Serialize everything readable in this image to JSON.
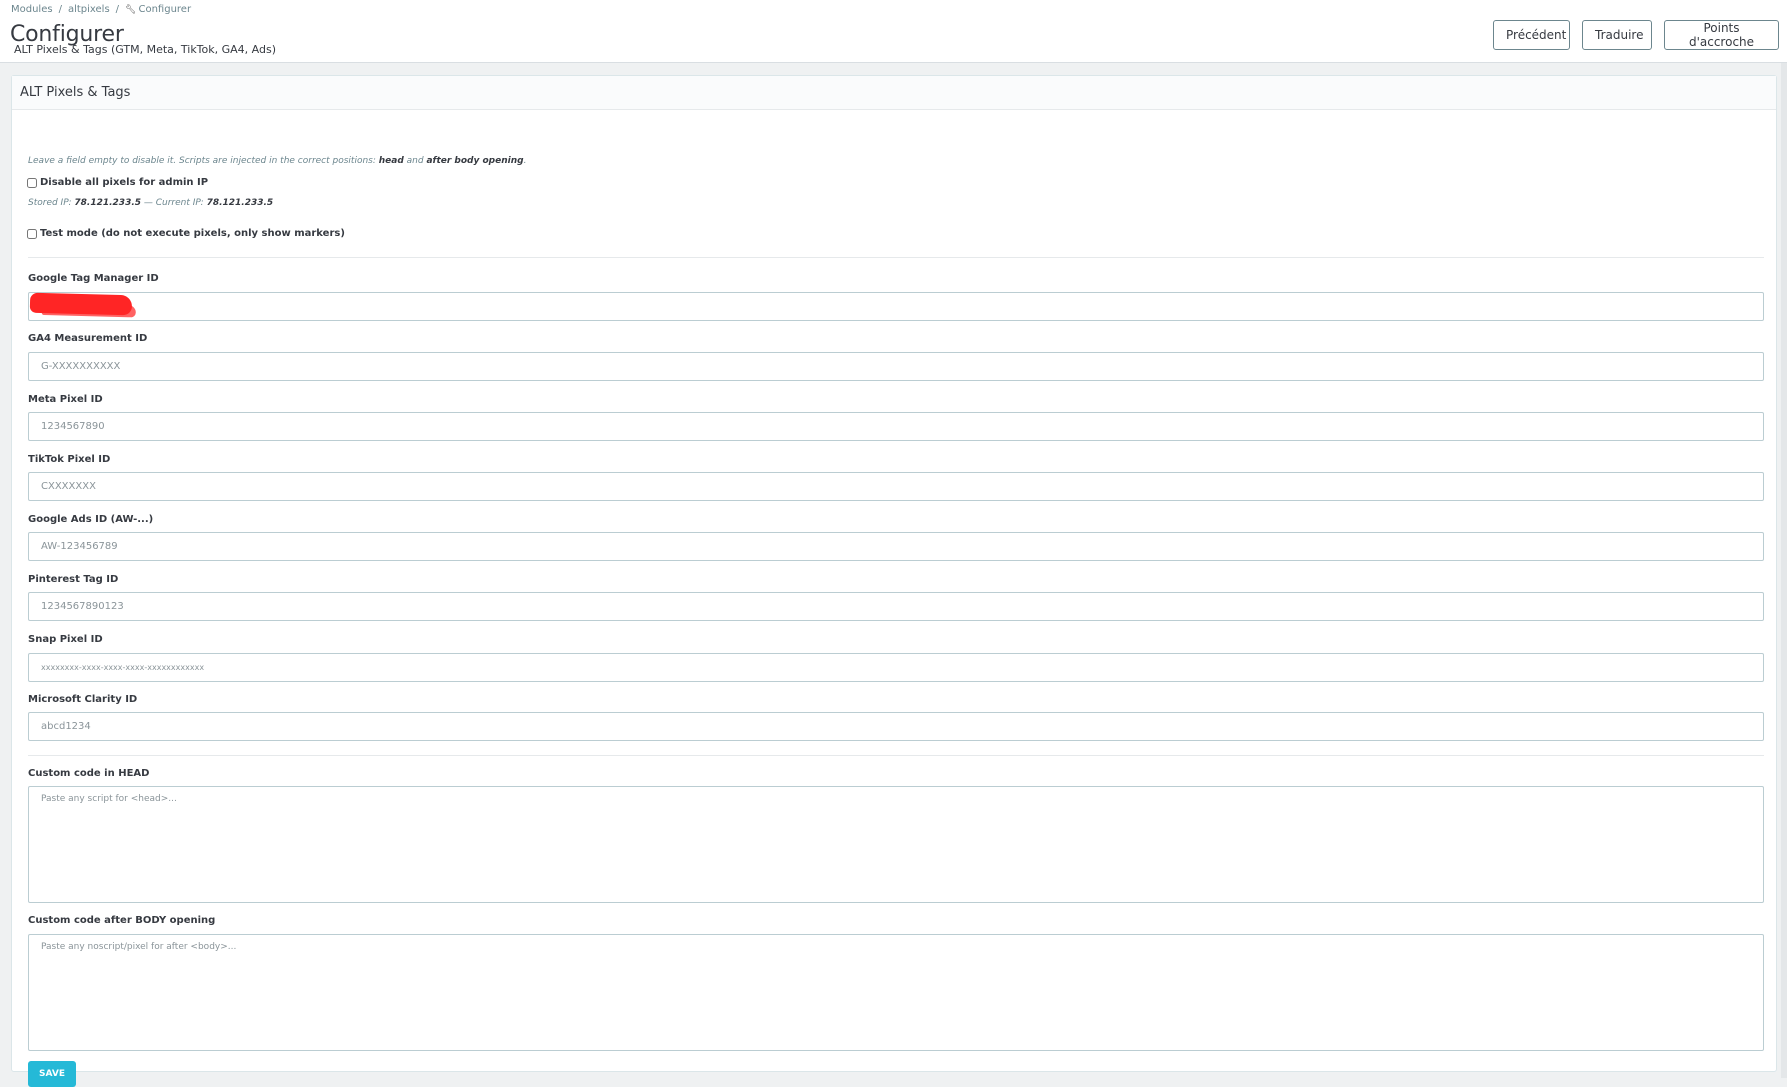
{
  "breadcrumb": {
    "items": [
      "Modules",
      "altpixels",
      "Configurer"
    ],
    "separator": "/"
  },
  "header": {
    "title": "Configurer",
    "subtitle": "ALT Pixels & Tags (GTM, Meta, TikTok, GA4, Ads)",
    "buttons": {
      "previous": "Précédent",
      "translate": "Traduire",
      "hooks": "Points d'accroche"
    }
  },
  "panel": {
    "title": "ALT Pixels & Tags",
    "help": {
      "prefix": "Leave a field empty to disable it. Scripts are injected in the correct positions: ",
      "head": "head",
      "and": " and ",
      "after_body": "after body opening",
      "suffix": "."
    },
    "admin_ip": {
      "label": "Disable all pixels for admin IP",
      "checked": false,
      "stored_label": "Stored IP: ",
      "stored_ip": "78.121.233.5",
      "current_label": " — Current IP: ",
      "current_ip": "78.121.233.5"
    },
    "test_mode": {
      "label": "Test mode (do not execute pixels, only show markers)",
      "checked": false
    },
    "fields": {
      "gtm": {
        "label": "Google Tag Manager ID",
        "value": "",
        "placeholder": ""
      },
      "ga4": {
        "label": "GA4 Measurement ID",
        "placeholder": "G-XXXXXXXXXX"
      },
      "meta": {
        "label": "Meta Pixel ID",
        "placeholder": "1234567890"
      },
      "tiktok": {
        "label": "TikTok Pixel ID",
        "placeholder": "CXXXXXXX"
      },
      "google_ads": {
        "label": "Google Ads ID (AW-...)",
        "placeholder": "AW-123456789"
      },
      "pinterest": {
        "label": "Pinterest Tag ID",
        "placeholder": "1234567890123"
      },
      "snap": {
        "label": "Snap Pixel ID",
        "placeholder": "xxxxxxxx-xxxx-xxxx-xxxx-xxxxxxxxxxxx"
      },
      "clarity": {
        "label": "Microsoft Clarity ID",
        "placeholder": "abcd1234"
      },
      "custom_head": {
        "label": "Custom code in HEAD",
        "placeholder": "Paste any script for <head>..."
      },
      "custom_body": {
        "label": "Custom code after BODY opening",
        "placeholder": "Paste any noscript/pixel for after <body>..."
      }
    },
    "save_label": "Save"
  },
  "colors": {
    "primary": "#25b9d7",
    "border": "#bbcdd2",
    "text": "#363a41",
    "muted": "#6c868e",
    "redaction": "#ff1a1a"
  }
}
